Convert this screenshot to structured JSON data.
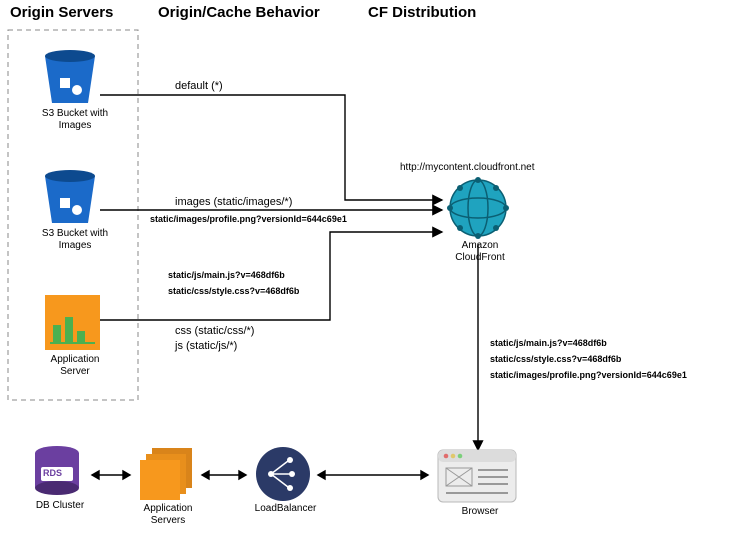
{
  "headings": {
    "origin": "Origin Servers",
    "behavior": "Origin/Cache Behavior",
    "dist": "CF Distribution"
  },
  "nodes": {
    "s3a": "S3 Bucket with\nImages",
    "s3b": "S3 Bucket with\nImages",
    "app": "Application\nServer",
    "cf": "Amazon\nCloudFront",
    "rds": "DB Cluster",
    "rds_badge": "RDS",
    "appservers": "Application\nServers",
    "lb": "LoadBalancer",
    "browser": "Browser"
  },
  "labels": {
    "default": "default (*)",
    "images": "images (static/images/*)",
    "images_ex": "static/images/profile.png?versionId=644c69e1",
    "mainjs": "static/js/main.js?v=468df6b",
    "stylecss": "static/css/style.css?v=468df6b",
    "css": "css (static/css/*)",
    "js": "js (static/js/*)",
    "cf_url": "http://mycontent.cloudfront.net",
    "out_js": "static/js/main.js?v=468df6b",
    "out_css": "static/css/style.css?v=468df6b",
    "out_img": "static/images/profile.png?versionId=644c69e1"
  },
  "colors": {
    "orange": "#f7981d",
    "purple": "#6b3fa0",
    "navy": "#2b3a67",
    "teal": "#1fa3bf",
    "green": "#4cb050"
  }
}
